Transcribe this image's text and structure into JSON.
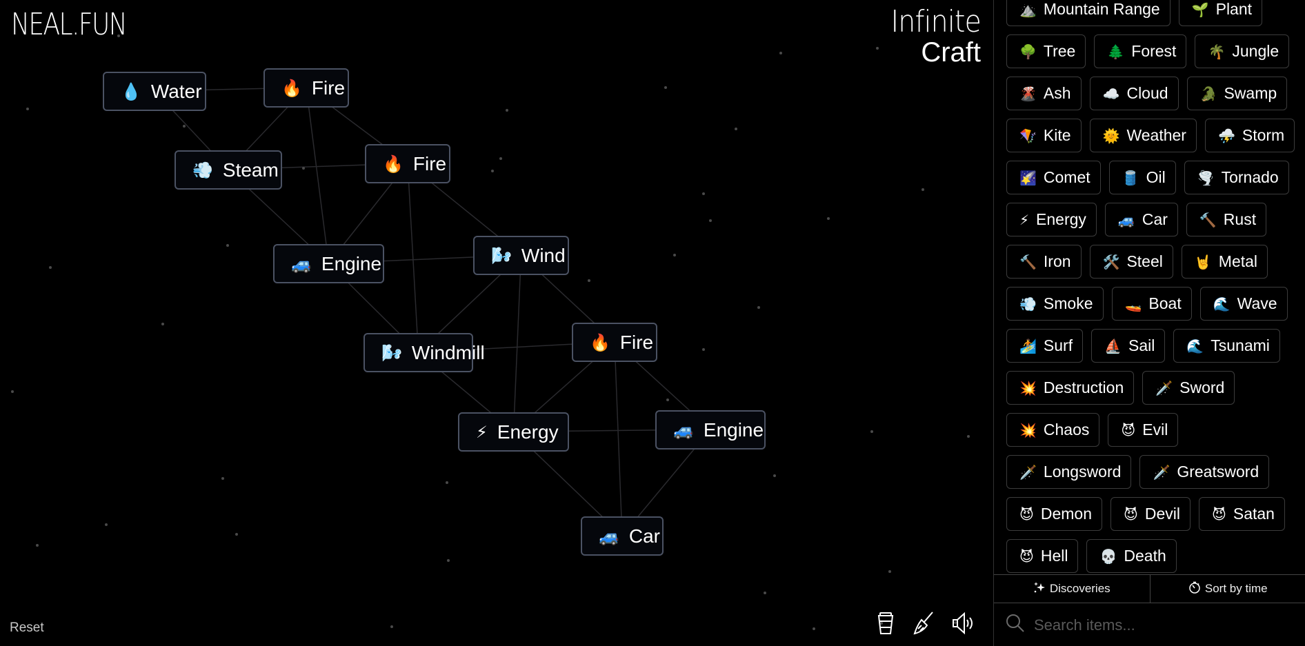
{
  "branding": {
    "site_logo": "NEAL.FUN",
    "game_title_line1": "Infinite",
    "game_title_line2": "Craft"
  },
  "canvas": {
    "nodes": [
      {
        "emoji": "💧",
        "icon": "water-drop-icon",
        "label": "Water"
      },
      {
        "emoji": "🔥",
        "icon": "fire-icon",
        "label": "Fire"
      },
      {
        "emoji": "💨",
        "icon": "steam-puff-icon",
        "label": "Steam"
      },
      {
        "emoji": "🔥",
        "icon": "fire-icon",
        "label": "Fire"
      },
      {
        "emoji": "🚙",
        "icon": "car-icon",
        "label": "Engine"
      },
      {
        "emoji": "🌬️",
        "icon": "wind-face-icon",
        "label": "Wind"
      },
      {
        "emoji": "🌬️",
        "icon": "wind-face-icon",
        "label": "Windmill"
      },
      {
        "emoji": "🔥",
        "icon": "fire-icon",
        "label": "Fire"
      },
      {
        "emoji": "⚡",
        "icon": "lightning-icon",
        "label": "Energy"
      },
      {
        "emoji": "🚙",
        "icon": "car-icon",
        "label": "Engine"
      },
      {
        "emoji": "🚙",
        "icon": "car-icon",
        "label": "Car"
      }
    ]
  },
  "controls": {
    "reset_label": "Reset",
    "donate_icon": "coffee-cup-icon",
    "clear_icon": "broom-icon",
    "sound_icon": "speaker-icon"
  },
  "sidebar": {
    "rows": [
      [
        {
          "emoji": "⛰️",
          "label": "Mountain Range"
        },
        {
          "emoji": "🌱",
          "label": "Plant"
        }
      ],
      [
        {
          "emoji": "🌳",
          "label": "Tree"
        },
        {
          "emoji": "🌲",
          "label": "Forest"
        },
        {
          "emoji": "🌴",
          "label": "Jungle"
        }
      ],
      [
        {
          "emoji": "🌋",
          "label": "Ash"
        },
        {
          "emoji": "☁️",
          "label": "Cloud"
        },
        {
          "emoji": "🐊",
          "label": "Swamp"
        }
      ],
      [
        {
          "emoji": "🪁",
          "label": "Kite"
        },
        {
          "emoji": "🌞",
          "label": "Weather"
        },
        {
          "emoji": "⛈️",
          "label": "Storm"
        }
      ],
      [
        {
          "emoji": "🌠",
          "label": "Comet"
        },
        {
          "emoji": "🛢️",
          "label": "Oil"
        },
        {
          "emoji": "🌪️",
          "label": "Tornado"
        }
      ],
      [
        {
          "emoji": "⚡",
          "label": "Energy"
        },
        {
          "emoji": "🚙",
          "label": "Car"
        },
        {
          "emoji": "🔨",
          "label": "Rust"
        }
      ],
      [
        {
          "emoji": "🔨",
          "label": "Iron"
        },
        {
          "emoji": "🛠️",
          "label": "Steel"
        },
        {
          "emoji": "🤘",
          "label": "Metal"
        }
      ],
      [
        {
          "emoji": "💨",
          "label": "Smoke"
        },
        {
          "emoji": "🚤",
          "label": "Boat"
        },
        {
          "emoji": "🌊",
          "label": "Wave"
        }
      ],
      [
        {
          "emoji": "🏄",
          "label": "Surf"
        },
        {
          "emoji": "⛵",
          "label": "Sail"
        },
        {
          "emoji": "🌊",
          "label": "Tsunami"
        }
      ],
      [
        {
          "emoji": "💥",
          "label": "Destruction"
        },
        {
          "emoji": "🗡️",
          "label": "Sword"
        }
      ],
      [
        {
          "emoji": "💥",
          "label": "Chaos"
        },
        {
          "emoji": "😈",
          "label": "Evil"
        }
      ],
      [
        {
          "emoji": "🗡️",
          "label": "Longsword"
        },
        {
          "emoji": "🗡️",
          "label": "Greatsword"
        }
      ],
      [
        {
          "emoji": "😈",
          "label": "Demon"
        },
        {
          "emoji": "😈",
          "label": "Devil"
        },
        {
          "emoji": "😈",
          "label": "Satan"
        }
      ],
      [
        {
          "emoji": "😈",
          "label": "Hell"
        },
        {
          "emoji": "💀",
          "label": "Death"
        }
      ]
    ],
    "discoveries_label": "Discoveries",
    "discoveries_icon": "sparkles-icon",
    "sort_label": "Sort by time",
    "sort_icon": "stopwatch-icon",
    "search_placeholder": "Search items...",
    "search_value": ""
  }
}
